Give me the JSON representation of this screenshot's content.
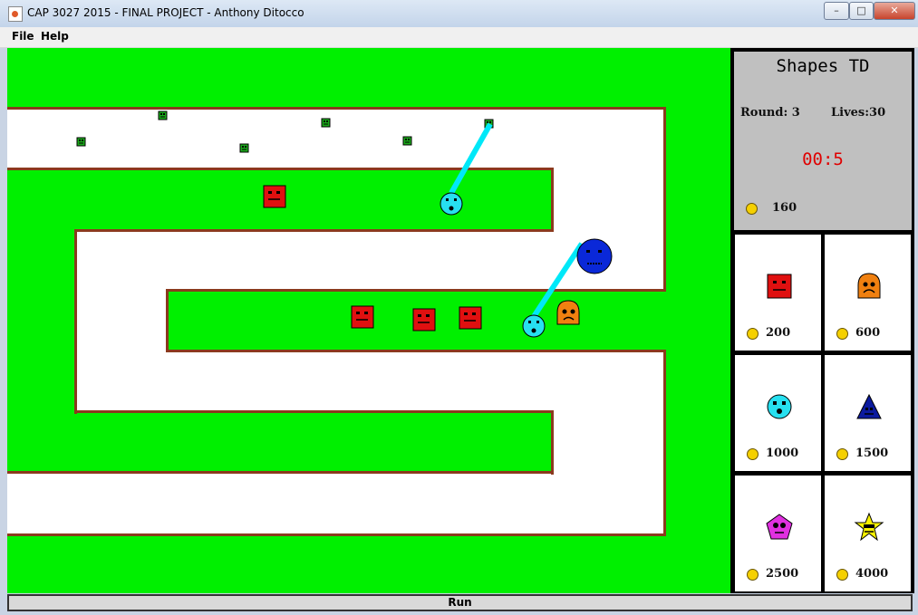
{
  "window": {
    "title": "CAP 3027 2015 - FINAL PROJECT - Anthony Ditocco",
    "buttons": {
      "minimize": "–",
      "maximize": "□",
      "close": "✕"
    }
  },
  "menu": {
    "items": [
      {
        "label": "File"
      },
      {
        "label": "Help"
      }
    ]
  },
  "info": {
    "title": "Shapes TD",
    "round_label": "Round: 3",
    "lives_label": "Lives:30",
    "timer": "00:5",
    "money": "160"
  },
  "shop": {
    "towers": [
      {
        "shape": "square",
        "color": "#e01010",
        "cost": "200"
      },
      {
        "shape": "blob",
        "color": "#f08010",
        "cost": "600"
      },
      {
        "shape": "circle",
        "color": "#27e0f0",
        "cost": "1000"
      },
      {
        "shape": "triangle",
        "color": "#0b1a9e",
        "cost": "1500"
      },
      {
        "shape": "pentagon",
        "color": "#e030e0",
        "cost": "2500"
      },
      {
        "shape": "star",
        "color": "#f7f200",
        "cost": "4000"
      }
    ]
  },
  "controls": {
    "run_label": "Run"
  },
  "colors": {
    "grass": "#00f000",
    "path": "#ffffff",
    "wall": "#8b3a1e",
    "laser": "#00e8f8",
    "coin": "#f5d000"
  },
  "icons": {
    "coin": "gold-coin-icon"
  }
}
